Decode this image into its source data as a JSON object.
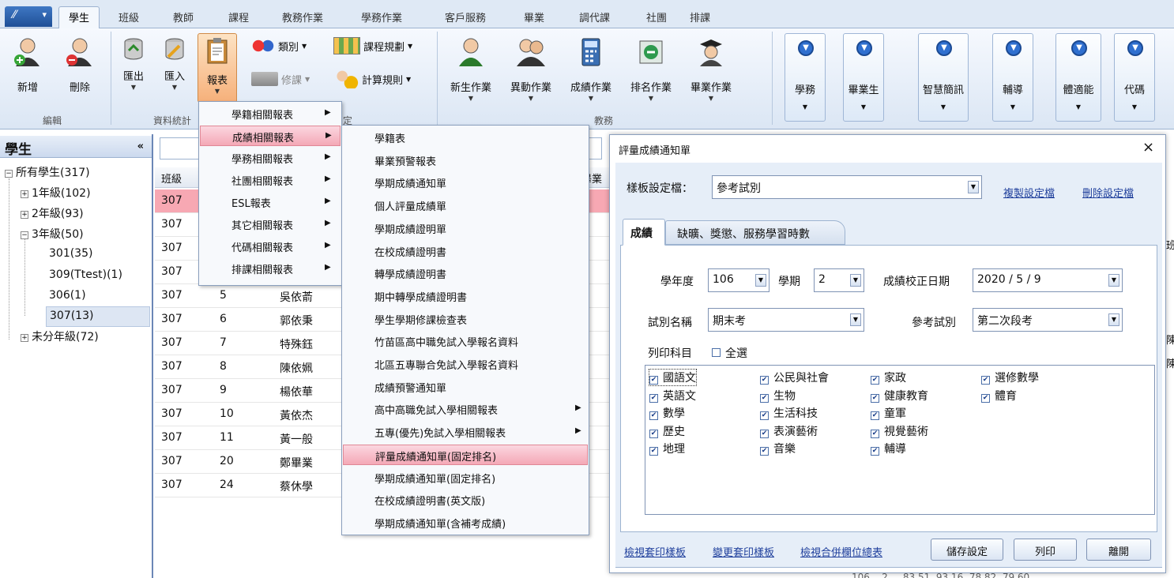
{
  "ribbon": {
    "tabs": [
      "學生",
      "班級",
      "教師",
      "課程",
      "教務作業",
      "學務作業",
      "客戶服務",
      "畢業",
      "調代課",
      "社團",
      "排課"
    ],
    "edit_group": {
      "buttons": [
        "新增",
        "刪除"
      ],
      "label": "編輯"
    },
    "data_group": {
      "buttons": [
        "匯出",
        "匯入",
        "報表"
      ],
      "label_left": "資料統計",
      "label_right": "定"
    },
    "small": {
      "category": "類別",
      "course_plan": "課程規劃",
      "elective": "修課",
      "calc_rules": "計算規則"
    },
    "academic": {
      "buttons": [
        "新生作業",
        "異動作業",
        "成績作業",
        "排名作業",
        "畢業作業"
      ],
      "label": "教務"
    },
    "right_buttons": [
      "學務",
      "畢業生",
      "智慧簡訊",
      "輔導",
      "體適能",
      "代碼"
    ]
  },
  "sidebar": {
    "title": "學生",
    "collapse": "«",
    "tree": {
      "root": "所有學生(317)",
      "g1": "1年級(102)",
      "g2": "2年級(93)",
      "g3": "3年級(50)",
      "c301": "301(35)",
      "c309": "309(Ttest)(1)",
      "c306": "306(1)",
      "c307": "307(13)",
      "ungraded": "未分年級(72)"
    }
  },
  "grid": {
    "header": {
      "class": "班級",
      "extra": "畢業"
    },
    "rows": [
      {
        "cls": "307",
        "no": "",
        "name": ""
      },
      {
        "cls": "307",
        "no": "",
        "name": ""
      },
      {
        "cls": "307",
        "no": "",
        "name": ""
      },
      {
        "cls": "307",
        "no": "",
        "name": ""
      },
      {
        "cls": "307",
        "no": "5",
        "name": "吳依萮"
      },
      {
        "cls": "307",
        "no": "6",
        "name": "郭依秉"
      },
      {
        "cls": "307",
        "no": "7",
        "name": "特殊鈺"
      },
      {
        "cls": "307",
        "no": "8",
        "name": "陳依姵"
      },
      {
        "cls": "307",
        "no": "9",
        "name": "楊依華"
      },
      {
        "cls": "307",
        "no": "10",
        "name": "黃依杰"
      },
      {
        "cls": "307",
        "no": "11",
        "name": "黃一般"
      },
      {
        "cls": "307",
        "no": "20",
        "name": "鄭畢業"
      },
      {
        "cls": "307",
        "no": "24",
        "name": "蔡休學"
      }
    ],
    "right_edge": {
      "r1": "班",
      "r2": "陳",
      "r3": "陳"
    },
    "bottom_partial": "106    2     83.51  93.16  78.82  79.60"
  },
  "report_menu": [
    "學籍相關報表",
    "成績相關報表",
    "學務相關報表",
    "社團相關報表",
    "ESL報表",
    "其它相關報表",
    "代碼相關報表",
    "排課相關報表"
  ],
  "score_menu": [
    "學籍表",
    "畢業預警報表",
    "學期成績通知單",
    "個人評量成績單",
    "學期成績證明單",
    "在校成績證明書",
    "轉學成績證明書",
    "期中轉學成績證明書",
    "學生學期修課檢查表",
    "竹苗區高中職免試入學報名資料",
    "北區五專聯合免試入學報名資料",
    "成績預警通知單",
    "高中高職免試入學相關報表",
    "五專(優先)免試入學相關報表",
    "評量成績通知單(固定排名)",
    "學期成績通知單(固定排名)",
    "在校成績證明書(英文版)",
    "學期成績通知單(含補考成績)"
  ],
  "dialog": {
    "title": "評量成績通知單",
    "close": "×",
    "template_label": "樣板設定檔：",
    "template_value": "參考試別",
    "copy_link": "複製設定檔",
    "delete_link": "刪除設定檔",
    "tabs": [
      "成績",
      "缺曠、獎懲、服務學習時數"
    ],
    "year_label": "學年度",
    "year_value": "106",
    "sem_label": "學期",
    "sem_value": "2",
    "date_label": "成績校正日期",
    "date_value": "2020 / 5 / 9",
    "exam_label": "試別名稱",
    "exam_value": "期末考",
    "ref_label": "參考試別",
    "ref_value": "第二次段考",
    "subjects_label": "列印科目",
    "select_all": "全選",
    "subjects": [
      [
        "國語文",
        "英語文",
        "數學",
        "歷史",
        "地理"
      ],
      [
        "公民與社會",
        "生物",
        "生活科技",
        "表演藝術",
        "音樂"
      ],
      [
        "家政",
        "健康教育",
        "童軍",
        "視覺藝術",
        "輔導"
      ],
      [
        "選修數學",
        "體育"
      ]
    ],
    "footer_links": [
      "檢視套印樣板",
      "變更套印樣板",
      "檢視合併欄位總表"
    ],
    "buttons": [
      "儲存設定",
      "列印",
      "離開"
    ]
  },
  "colors": {
    "accent": "#2f6fcf",
    "highlight": "#f4a8b6",
    "link": "#1f3f9c"
  }
}
